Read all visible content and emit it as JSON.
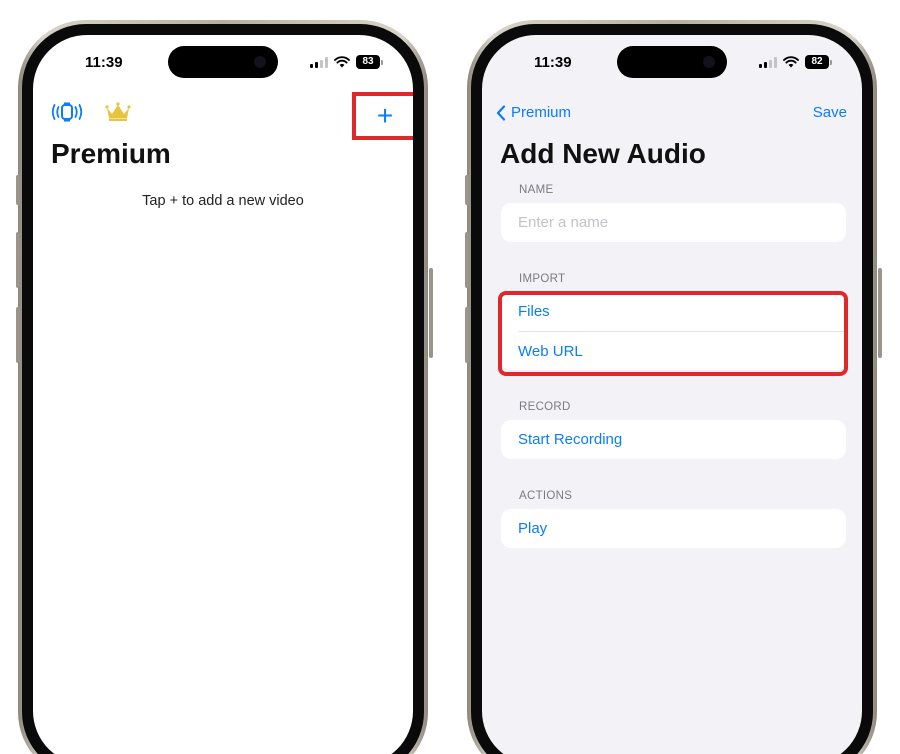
{
  "status_bar": {
    "left_phone": {
      "time": "11:39",
      "battery": "83"
    },
    "right_phone": {
      "time": "11:39",
      "battery": "82"
    }
  },
  "left_screen": {
    "nav_icons": [
      "watch-vibration-icon",
      "crown-icon"
    ],
    "add_button_label": "+",
    "title": "Premium",
    "empty_hint": "Tap + to add a new video"
  },
  "right_screen": {
    "back_label": "Premium",
    "save_label": "Save",
    "title": "Add New Audio",
    "sections": [
      {
        "header": "NAME",
        "rows": [
          {
            "label": "",
            "placeholder": "Enter a name"
          }
        ]
      },
      {
        "header": "IMPORT",
        "rows": [
          {
            "label": "Files"
          },
          {
            "label": "Web URL"
          }
        ]
      },
      {
        "header": "RECORD",
        "rows": [
          {
            "label": "Start Recording"
          }
        ]
      },
      {
        "header": "ACTIONS",
        "rows": [
          {
            "label": "Play"
          }
        ]
      }
    ]
  },
  "colors": {
    "accent": "#0a7cff",
    "highlight": "#e0282b",
    "grouped_background": "#f2f2f7",
    "crown": "#e8c33e"
  }
}
